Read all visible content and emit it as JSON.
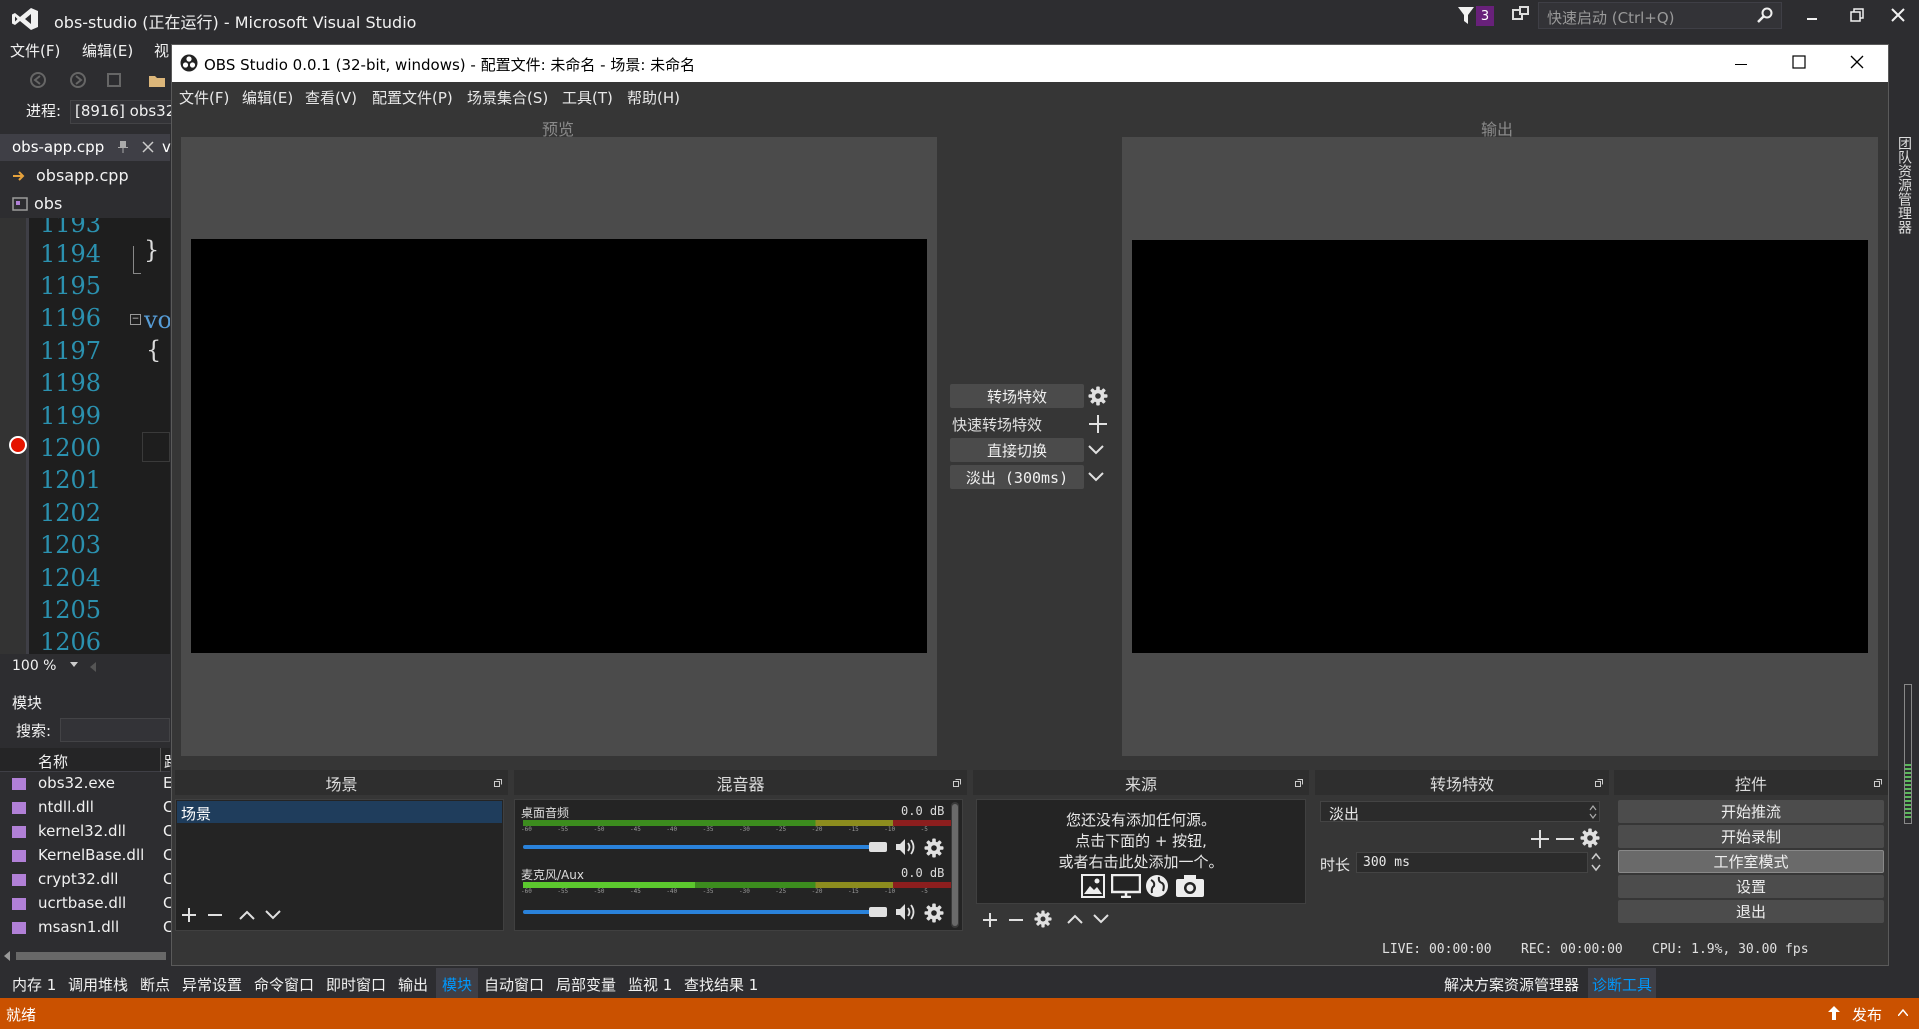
{
  "vs": {
    "title": "obs-studio (正在运行) - Microsoft Visual Studio",
    "notification_count": "3",
    "quick_launch_placeholder": "快速启动 (Ctrl+Q)",
    "menu": [
      "文件(F)",
      "编辑(E)",
      "视"
    ],
    "process_label": "进程:",
    "process_value": "[8916] obs32",
    "doc_tab": "obs-app.cpp",
    "doc_tab_cut": "v",
    "nav_file": "obsapp.cpp",
    "nav_scope": "obs",
    "line_numbers": [
      "1193",
      "1194",
      "1195",
      "1196",
      "1197",
      "1198",
      "1199",
      "1200",
      "1201",
      "1202",
      "1203",
      "1204",
      "1205",
      "1206"
    ],
    "code": {
      "brace_close": "}",
      "vo": "vo",
      "brace_open": "{"
    },
    "zoom": "100 %",
    "modules": {
      "title": "模块",
      "search_label": "搜索:",
      "col_name": "名称",
      "col_cut": "路",
      "rows": [
        {
          "name": "obs32.exe",
          "cut": "E"
        },
        {
          "name": "ntdll.dll",
          "cut": "C"
        },
        {
          "name": "kernel32.dll",
          "cut": "C"
        },
        {
          "name": "KernelBase.dll",
          "cut": "C"
        },
        {
          "name": "crypt32.dll",
          "cut": "C"
        },
        {
          "name": "ucrtbase.dll",
          "cut": "C"
        },
        {
          "name": "msasn1.dll",
          "cut": "C"
        }
      ]
    },
    "bottom_tabs": [
      "内存 1",
      "调用堆栈",
      "断点",
      "异常设置",
      "命令窗口",
      "即时窗口",
      "输出",
      "模块",
      "自动窗口",
      "局部变量",
      "监视 1",
      "查找结果 1"
    ],
    "active_bottom_tab": "模块",
    "right_tabs": [
      "解决方案资源管理器",
      "诊断工具"
    ],
    "side_vertical": "团队资源管理器",
    "status": "就绪",
    "publish": "发布"
  },
  "obs": {
    "title": "OBS Studio 0.0.1 (32-bit, windows) - 配置文件: 未命名 - 场景: 未命名",
    "menu": [
      "文件(F)",
      "编辑(E)",
      "查看(V)",
      "配置文件(P)",
      "场景集合(S)",
      "工具(T)",
      "帮助(H)"
    ],
    "preview_label": "预览",
    "output_label": "输出",
    "transition": {
      "button": "转场特效",
      "quick_label": "快速转场特效",
      "quick_items": [
        "直接切换",
        "淡出 (300ms)"
      ]
    },
    "docks": {
      "scenes": {
        "title": "场景",
        "items": [
          "场景"
        ]
      },
      "mixer": {
        "title": "混音器",
        "channels": [
          {
            "name": "桌面音频",
            "db": "0.0 dB"
          },
          {
            "name": "麦克风/Aux",
            "db": "0.0 dB"
          }
        ],
        "ticks": [
          "-60",
          "-55",
          "-50",
          "-45",
          "-40",
          "-35",
          "-30",
          "-25",
          "-20",
          "-15",
          "-10",
          "-5",
          "0"
        ]
      },
      "sources": {
        "title": "来源",
        "empty_lines": [
          "您还没有添加任何源。",
          "点击下面的 + 按钮,",
          "或者右击此处添加一个。"
        ]
      },
      "transitions": {
        "title": "转场特效",
        "selected": "淡出",
        "duration_label": "时长",
        "duration_value": "300 ms"
      },
      "controls": {
        "title": "控件",
        "buttons": [
          "开始推流",
          "开始录制",
          "工作室模式",
          "设置",
          "退出"
        ]
      }
    },
    "status": {
      "live": "LIVE: 00:00:00",
      "rec": "REC: 00:00:00",
      "cpu": "CPU: 1.9%, 30.00 fps"
    }
  }
}
